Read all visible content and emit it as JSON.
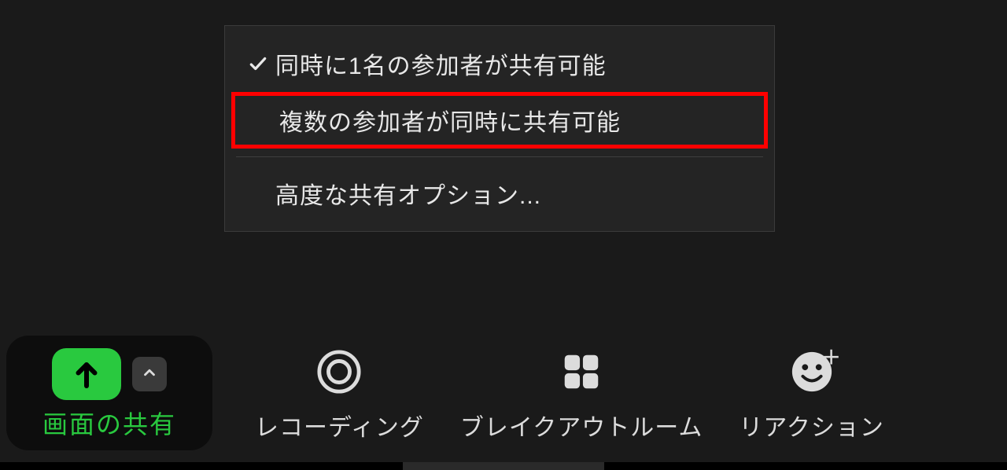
{
  "menu": {
    "items": [
      {
        "label": "同時に1名の参加者が共有可能",
        "checked": true
      },
      {
        "label": "複数の参加者が同時に共有可能",
        "highlighted": true
      }
    ],
    "advanced_label": "高度な共有オプション..."
  },
  "toolbar": {
    "share": {
      "label": "画面の共有"
    },
    "record": {
      "label": "レコーディング"
    },
    "breakout": {
      "label": "ブレイクアウトルーム"
    },
    "reaction": {
      "label": "リアクション"
    }
  },
  "colors": {
    "accent_green": "#29c93f",
    "highlight_red": "#ff0000"
  }
}
